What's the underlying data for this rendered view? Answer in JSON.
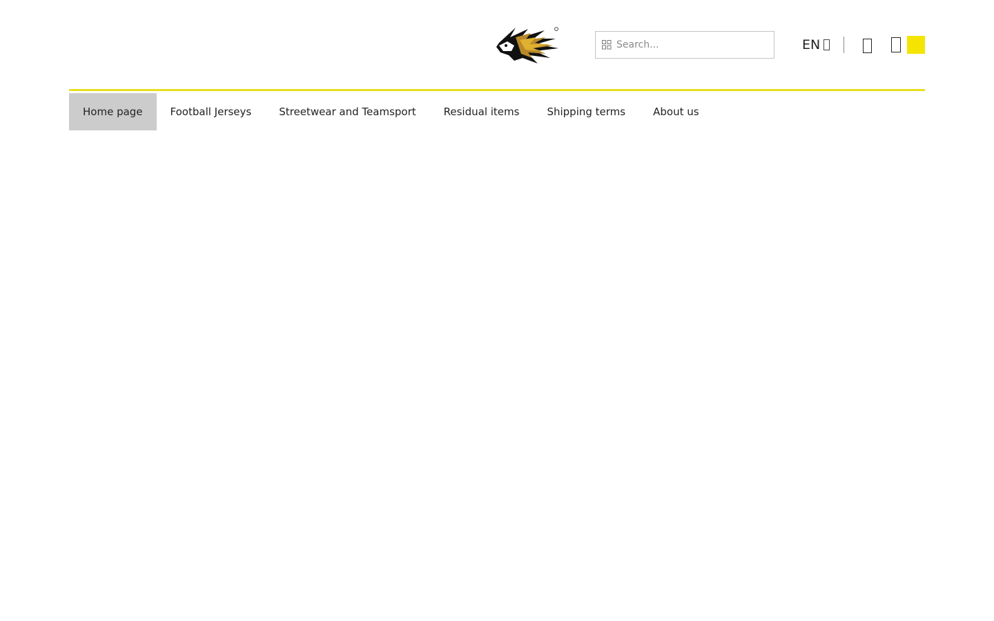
{
  "header": {
    "logo_icon": "lion-logo",
    "search": {
      "placeholder": "Search...",
      "value": "",
      "icon": "search-icon"
    },
    "language": {
      "label": "EN",
      "icon": "chevron-down-icon"
    },
    "user_icon": "user-icon",
    "cart_icon": "cart-icon"
  },
  "colors": {
    "accent": "#f5e400",
    "accent_line": "#e8df1c",
    "active_nav_bg": "#cccccc",
    "text": "#222222"
  },
  "nav": {
    "items": [
      {
        "label": "Home page",
        "active": true
      },
      {
        "label": "Football Jerseys",
        "active": false
      },
      {
        "label": "Streetwear and Teamsport",
        "active": false
      },
      {
        "label": "Residual items",
        "active": false
      },
      {
        "label": "Shipping terms",
        "active": false
      },
      {
        "label": "About us",
        "active": false
      }
    ]
  }
}
